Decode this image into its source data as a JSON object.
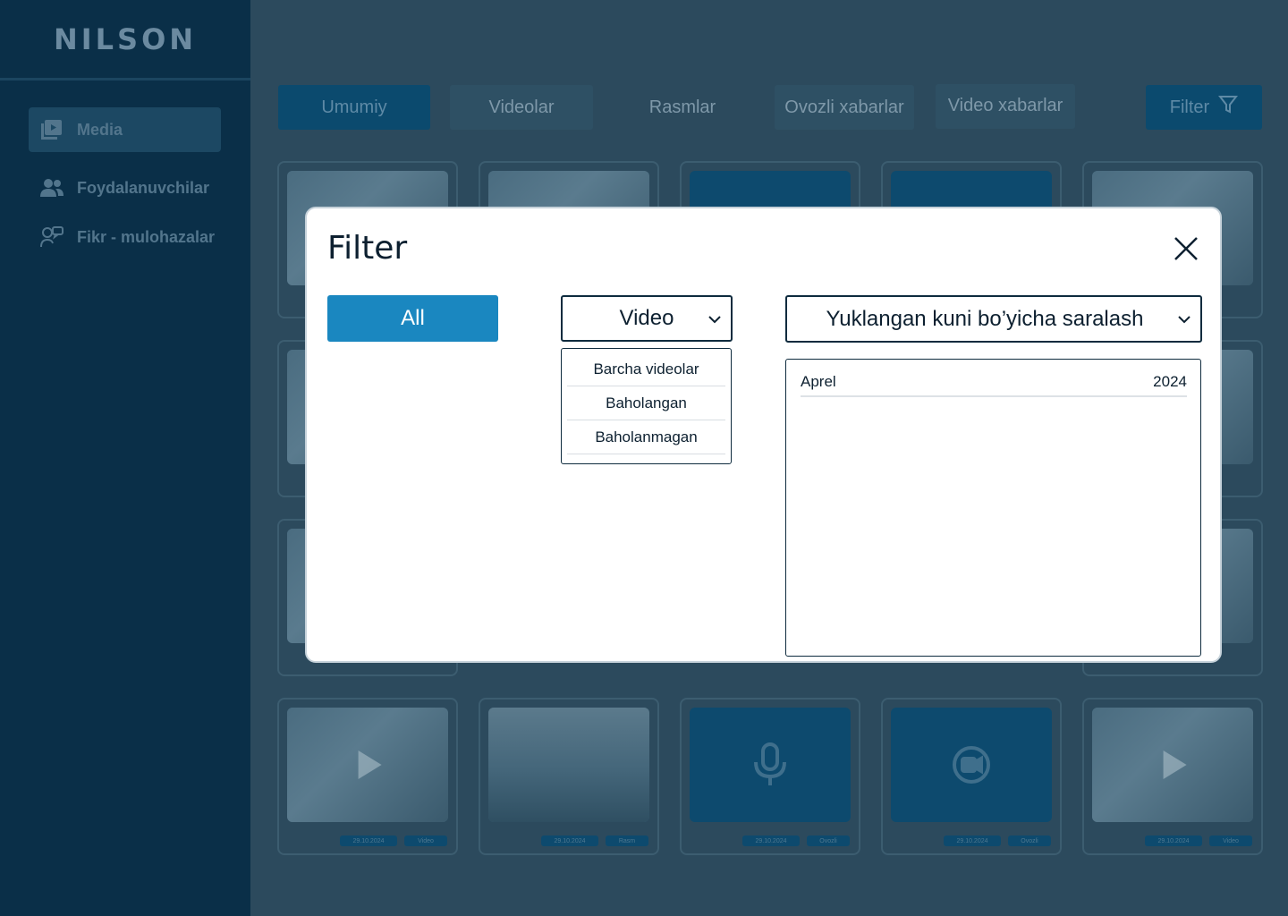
{
  "app": {
    "logo": "NILSON"
  },
  "sidebar": {
    "items": [
      {
        "label": "Media",
        "icon": "media-icon",
        "active": true
      },
      {
        "label": "Foydalanuvchilar",
        "icon": "users-icon",
        "active": false
      },
      {
        "label": "Fikr - mulohazalar",
        "icon": "feedback-icon",
        "active": false
      }
    ]
  },
  "tabs": [
    {
      "label": "Umumiy",
      "active": true
    },
    {
      "label": "Videolar",
      "active": false
    },
    {
      "label": "Rasmlar",
      "active": false
    },
    {
      "label": "Ovozli xabarlar",
      "active": false
    },
    {
      "label": "Video xabarlar",
      "active": false
    }
  ],
  "filter_button": {
    "label": "Filter"
  },
  "cards_bottom_row": [
    {
      "type": "video",
      "date": "29.10.2024",
      "tag": "Video"
    },
    {
      "type": "image",
      "date": "29.10.2024",
      "tag": "Rasm"
    },
    {
      "type": "voice",
      "date": "29.10.2024",
      "tag": "Ovozli"
    },
    {
      "type": "videomsg",
      "date": "29.10.2024",
      "tag": "Ovozli"
    },
    {
      "type": "video",
      "date": "29.10.2024",
      "tag": "Video"
    }
  ],
  "dialog": {
    "title": "Filter",
    "all_button": "All",
    "type_select": {
      "value": "Video"
    },
    "type_options": [
      "Barcha videolar",
      "Baholangan",
      "Baholanmagan"
    ],
    "sort_select": {
      "value": "Yuklangan kuni bo’yicha saralash"
    },
    "date_row": {
      "month": "Aprel",
      "year": "2024"
    }
  },
  "colors": {
    "accent": "#1a87c0",
    "sidebar": "#0a2f48",
    "overlay": "#2c4a5d"
  }
}
